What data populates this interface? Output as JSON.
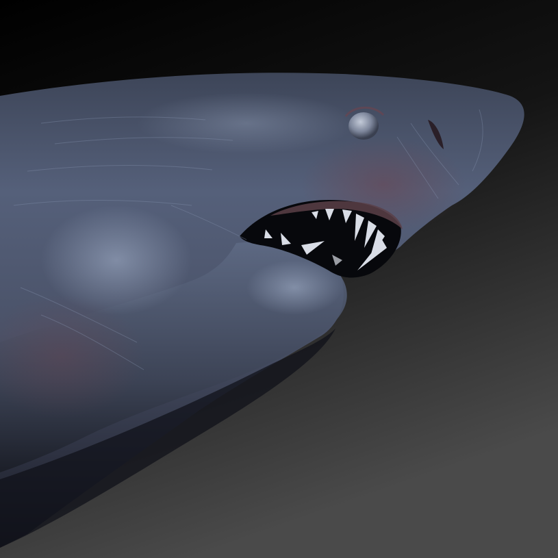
{
  "scene": {
    "subject": "shark-head-sculpt",
    "colors": {
      "background_top": "#000000",
      "background_bottom": "#4a4a4a",
      "skin_light": "#6f7c96",
      "skin_mid": "#4d5770",
      "skin_dark": "#2a2f3e",
      "skin_shadow": "#151820",
      "mouth_interior": "#07080c",
      "gum": "#5a4048",
      "teeth": "#d9dde6",
      "eye": "#8a93a8"
    }
  }
}
